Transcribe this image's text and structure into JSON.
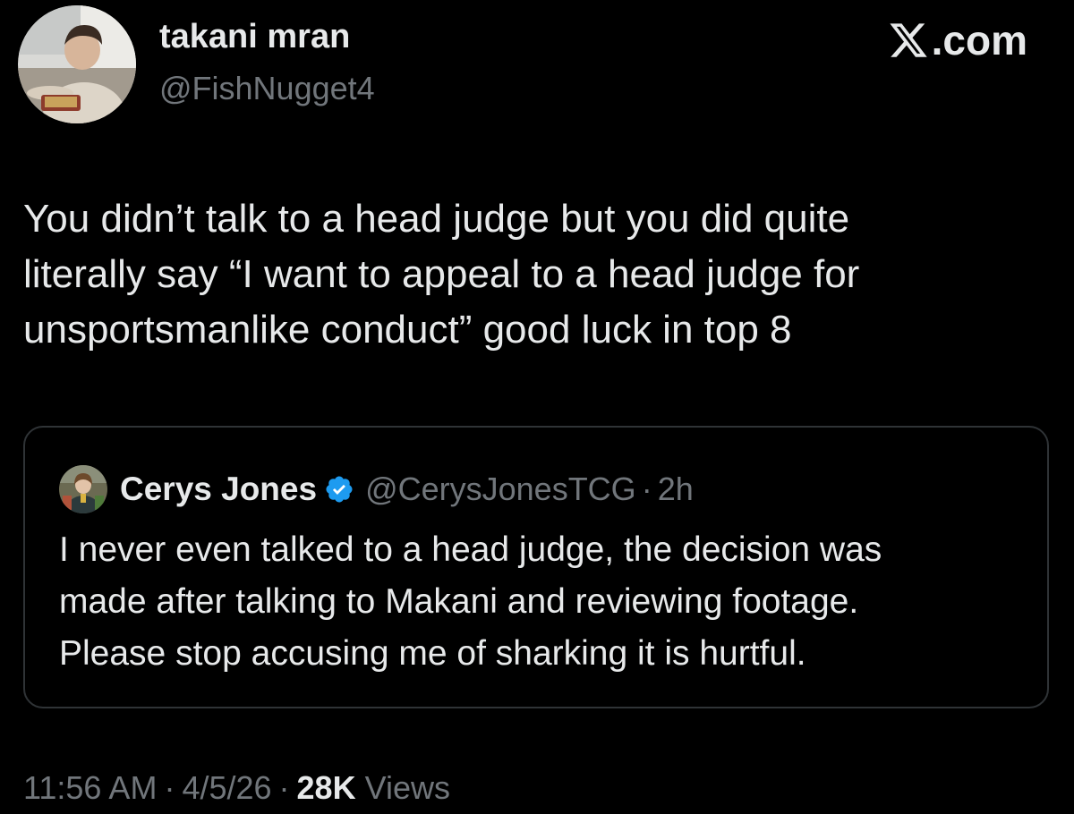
{
  "author": {
    "display_name": "takani mran",
    "handle": "@FishNugget4",
    "avatar_icon": "profile-photo-avatar"
  },
  "brand": {
    "logo_icon": "x-logo-icon",
    "text": ".com"
  },
  "tweet": {
    "lines": [
      "You didn’t talk to a head judge but you did quite",
      "literally say “I want to appeal to a head judge for",
      "unsportsmanlike conduct” good luck in top 8"
    ]
  },
  "quote": {
    "display_name": "Cerys Jones",
    "verified": true,
    "verified_icon": "verified-badge-icon",
    "verified_color": "#1d9bf0",
    "handle": "@CerysJonesTCG",
    "separator": "·",
    "time": "2h",
    "lines": [
      "I never even talked to a head judge, the decision was",
      "made after talking to Makani and reviewing footage.",
      "Please stop accusing me of sharking it is hurtful."
    ]
  },
  "meta": {
    "time": "11:56 AM",
    "date": "4/5/26",
    "separator": "·",
    "views_count": "28K",
    "views_label": "Views"
  },
  "colors": {
    "background": "#000000",
    "primary_text": "#e7e9ea",
    "secondary_text": "#71767b",
    "border": "#2f3336"
  }
}
